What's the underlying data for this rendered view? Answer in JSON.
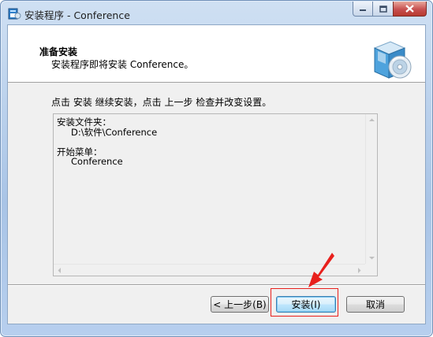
{
  "window": {
    "title": "安装程序 - Conference",
    "caption_buttons": {
      "minimize": "minimize-icon",
      "maximize": "maximize-icon",
      "close": "close-icon"
    }
  },
  "header": {
    "title": "准备安装",
    "subtitle": "安装程序即将安装 Conference。",
    "icon": "setup-box-cd-icon"
  },
  "instruction": "点击 安装 继续安装，点击 上一步 检查并改变设置。",
  "memo": {
    "install_dir_label": "安装文件夹：",
    "install_dir_value": "D:\\软件\\Conference",
    "start_menu_label": "开始菜单：",
    "start_menu_value": "Conference"
  },
  "buttons": {
    "back": "< 上一步(B)",
    "install": "安装(I)",
    "cancel": "取消"
  },
  "annotation": {
    "color": "#e8201c"
  }
}
